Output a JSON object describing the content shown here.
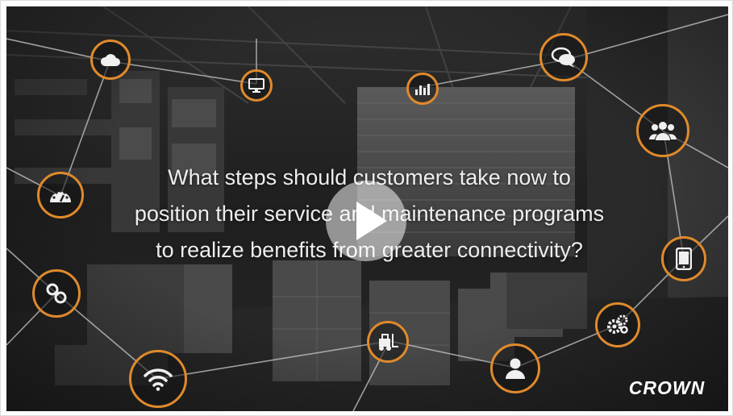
{
  "video": {
    "caption_lines": [
      "What steps should customers take now to",
      "position their service and maintenance programs",
      "to realize benefits from greater connectivity?"
    ],
    "brand": "CROWN",
    "accent_color": "#e08a2c"
  },
  "controls": {
    "play_icon": "play-icon"
  },
  "icons": [
    "cloud-icon",
    "monitor-icon",
    "bar-chart-icon",
    "chat-bubbles-icon",
    "users-group-icon",
    "speedometer-icon",
    "tablet-icon",
    "link-icon",
    "gears-icon",
    "wifi-icon",
    "forklift-icon",
    "user-icon"
  ]
}
